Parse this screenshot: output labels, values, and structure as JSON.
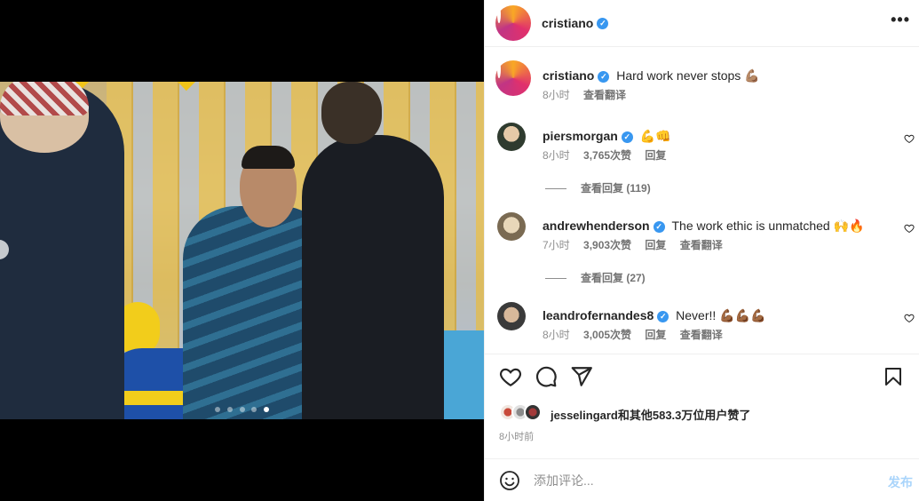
{
  "header": {
    "username": "cristiano",
    "more_label": "•••"
  },
  "caption": {
    "username": "cristiano",
    "text": "Hard work never stops 💪🏽",
    "time": "8小时",
    "translate": "查看翻译"
  },
  "comments": [
    {
      "username": "piersmorgan",
      "verified": true,
      "text": "💪👊",
      "time": "8小时",
      "likes": "3,765次赞",
      "reply": "回复",
      "translate": "",
      "view_replies": "查看回复 (119)"
    },
    {
      "username": "andrewhenderson",
      "verified": true,
      "text": "The work ethic is unmatched 🙌🔥",
      "time": "7小时",
      "likes": "3,903次赞",
      "reply": "回复",
      "translate": "查看翻译",
      "view_replies": "查看回复 (27)"
    },
    {
      "username": "leandrofernandes8",
      "verified": true,
      "text": "Never!! 💪🏾💪🏾💪🏾",
      "time": "8小时",
      "likes": "3,005次赞",
      "reply": "回复",
      "translate": "查看翻译",
      "view_replies": ""
    }
  ],
  "likes_summary": "jesselingard和其他583.3万位用户赞了",
  "post_time": "8小时前",
  "composer": {
    "placeholder": "添加评论...",
    "post_label": "发布"
  },
  "carousel": {
    "total_slides": 5,
    "active_slide": 5
  },
  "icons": {
    "like": "heart-icon",
    "comment": "comment-icon",
    "share": "share-icon",
    "save": "bookmark-icon",
    "emoji": "emoji-icon"
  },
  "colors": {
    "verified": "#3897f0",
    "post_button_disabled": "#a8d4fb"
  }
}
